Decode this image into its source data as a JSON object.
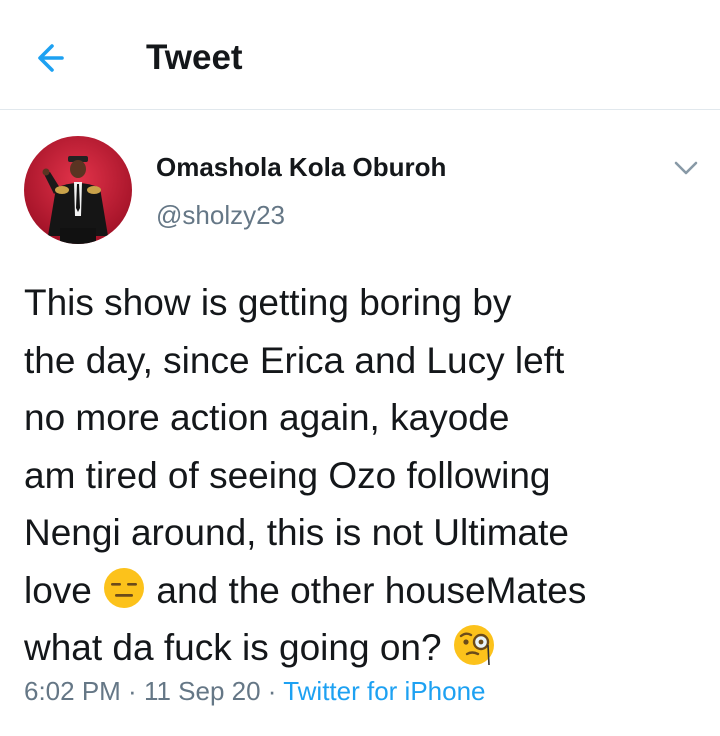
{
  "header": {
    "title": "Tweet",
    "back_icon": "arrow-left-icon",
    "accent_color": "#1da1f2"
  },
  "tweet": {
    "author": {
      "name": "Omashola Kola Oburoh",
      "handle": "@sholzy23",
      "avatar": "profile-photo"
    },
    "lines": [
      "This show is getting boring by",
      "the day, since Erica and Lucy left",
      "no more action again, kayode",
      "am tired of seeing Ozo following",
      "Nengi around, this is not Ultimate"
    ],
    "line6_before": "love ",
    "emoji1": "expressionless-face-emoji",
    "line6_after": " and the other houseMates",
    "line7": "what da fuck is going on? ",
    "emoji2": "face-with-monocle-emoji",
    "time": "6:02 PM",
    "sep1": " · ",
    "date": "11 Sep 20",
    "sep2": " · ",
    "source": "Twitter for iPhone",
    "more_icon": "chevron-down-icon"
  },
  "colors": {
    "text": "#14171a",
    "secondary": "#657786",
    "divider": "#e1e8ed",
    "link": "#1da1f2"
  }
}
